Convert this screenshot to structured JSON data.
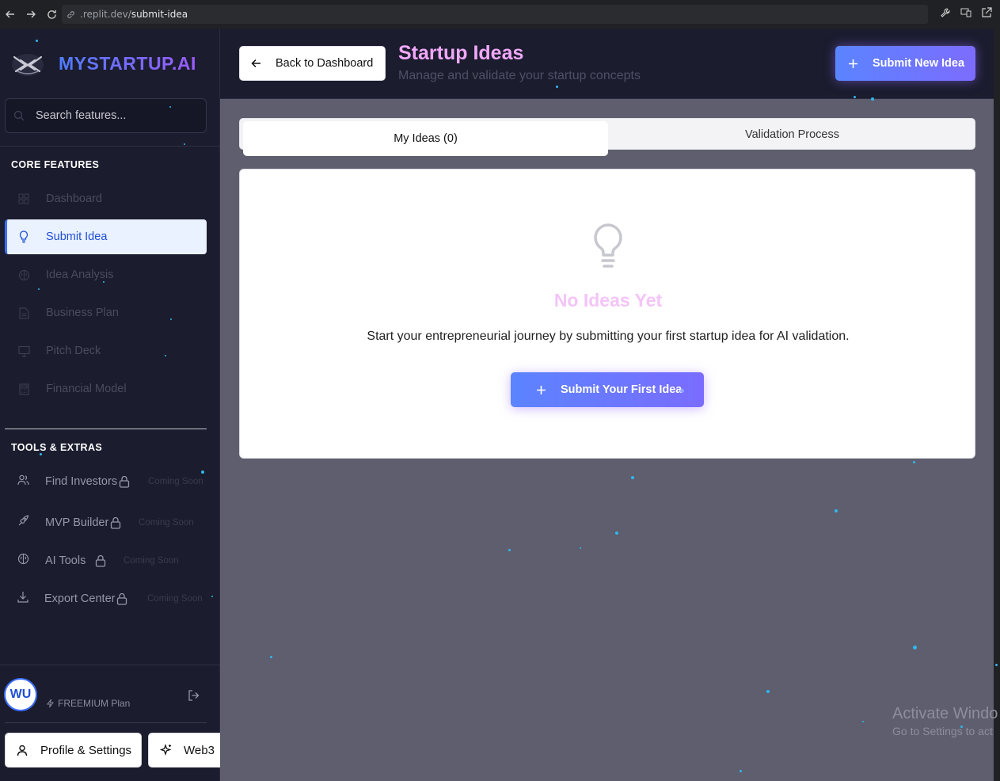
{
  "browser": {
    "url_prefix": ".replit.dev/",
    "url_path": "submit-idea"
  },
  "brand": {
    "name": "MYSTARTUP.AI"
  },
  "search": {
    "placeholder": "Search features..."
  },
  "sidebar": {
    "core_title": "CORE FEATURES",
    "core_items": [
      {
        "label": "Dashboard",
        "icon": "grid-icon"
      },
      {
        "label": "Submit Idea",
        "icon": "lightbulb-icon"
      },
      {
        "label": "Idea Analysis",
        "icon": "brain-icon"
      },
      {
        "label": "Business Plan",
        "icon": "document-icon"
      },
      {
        "label": "Pitch Deck",
        "icon": "presentation-icon"
      },
      {
        "label": "Financial Model",
        "icon": "calculator-icon"
      }
    ],
    "tools_title": "TOOLS & EXTRAS",
    "tools_items": [
      {
        "label": "Find Investors",
        "soon": "Coming Soon",
        "icon": "users-icon"
      },
      {
        "label": "MVP Builder",
        "soon": "Coming Soon",
        "icon": "rocket-icon"
      },
      {
        "label": "AI Tools",
        "soon": "Coming Soon",
        "icon": "brain-icon"
      },
      {
        "label": "Export Center",
        "soon": "Coming Soon",
        "icon": "download-icon"
      }
    ]
  },
  "user": {
    "initials": "WU",
    "plan": "FREEMIUM Plan"
  },
  "footer": {
    "profile_label": "Profile & Settings",
    "web3_label": "Web3"
  },
  "header": {
    "back_label": "Back to Dashboard",
    "title": "Startup Ideas",
    "subtitle": "Manage and validate your startup concepts",
    "submit_new_label": "Submit New Idea"
  },
  "tabs": [
    {
      "label": "My Ideas (0)",
      "active": true
    },
    {
      "label": "Validation Process",
      "active": false
    }
  ],
  "empty_state": {
    "title": "No Ideas Yet",
    "text": "Start your entrepreneurial journey by submitting your first startup idea for AI validation.",
    "button_label": "Submit Your First Idea"
  },
  "watermark": {
    "line1": "Activate Windo",
    "line2": "Go to Settings to act"
  },
  "colors": {
    "accent": "#5b84ff",
    "title_pink": "#f0a8f8",
    "sidebar_bg": "#1b1c2e",
    "main_bg": "#5e5e6e"
  }
}
